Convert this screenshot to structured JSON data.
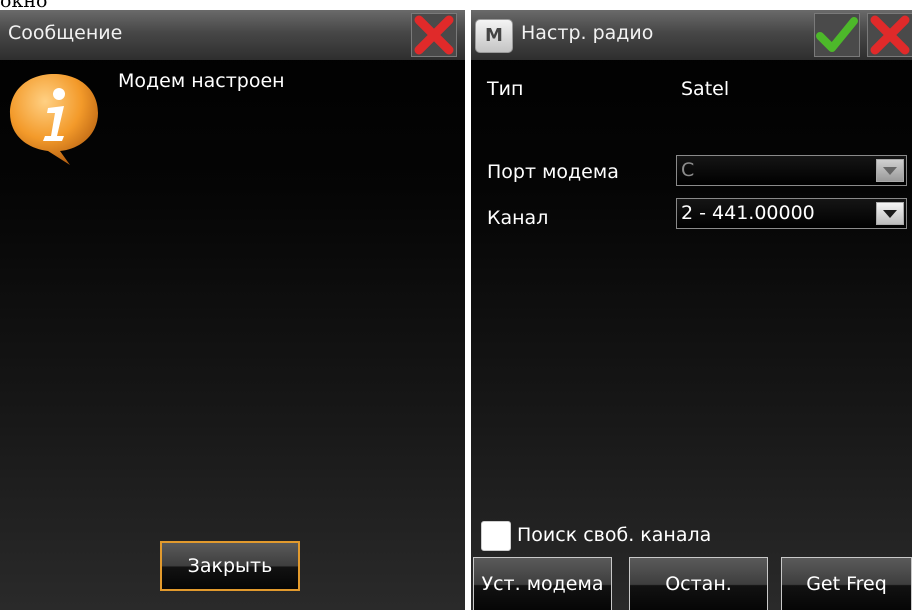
{
  "caption": "окно",
  "message_dialog": {
    "title": "Сообщение",
    "message": "Модем настроен",
    "close_label": "Закрыть",
    "icons": {
      "close": "close-x-icon",
      "info": "info-bubble-icon"
    }
  },
  "radio_settings": {
    "title": "Настр. радио",
    "modem_icon_letter": "M",
    "type_label": "Тип",
    "type_value": "Satel",
    "port_label": "Порт модема",
    "port_value": "C",
    "channel_label": "Канал",
    "channel_value": "2 - 441.00000",
    "free_channel_search_label": "Поиск своб. канала",
    "free_channel_search_checked": false,
    "buttons": {
      "set_modem": "Уст. модема",
      "stop": "Остан.",
      "get_freq": "Get Freq"
    },
    "icons": {
      "ok": "checkmark-icon",
      "cancel": "close-x-icon",
      "modem": "modem-icon"
    }
  },
  "colors": {
    "accent_orange": "#e29a2d",
    "close_red": "#e02a2a",
    "ok_green": "#4db82a",
    "background": "#000000"
  }
}
